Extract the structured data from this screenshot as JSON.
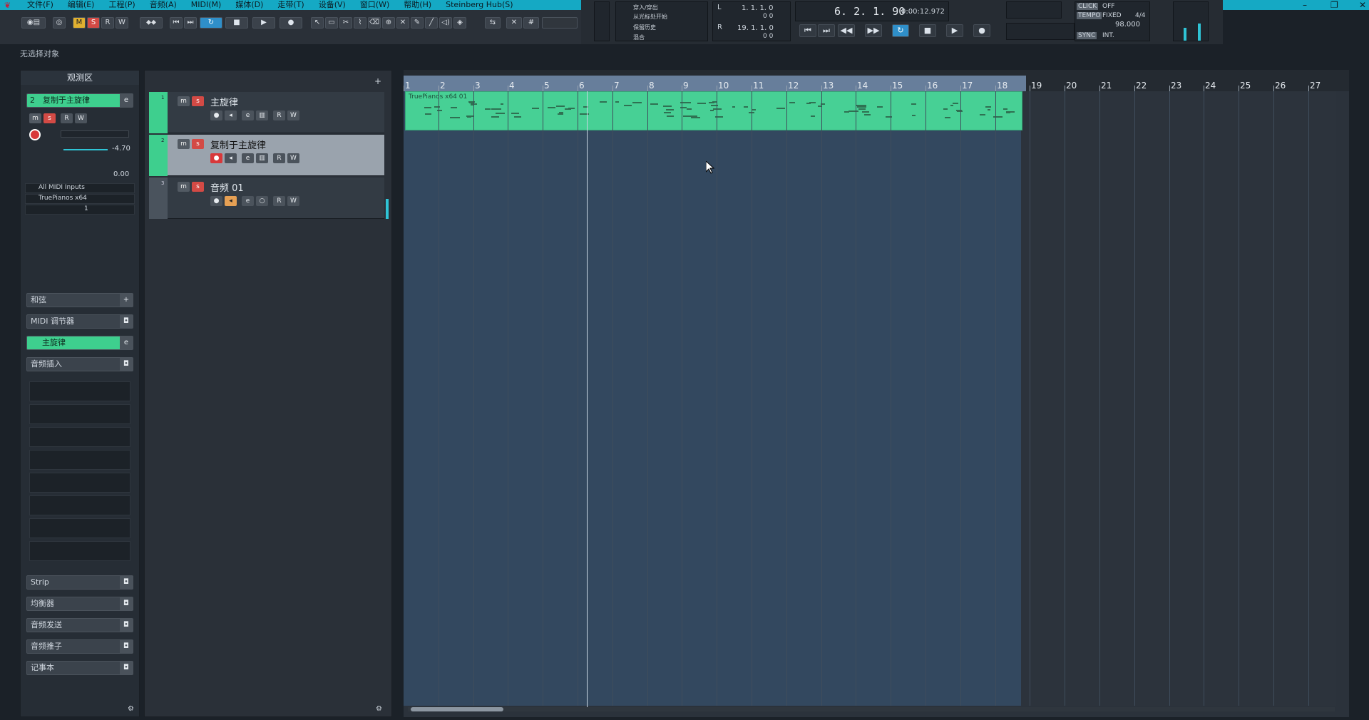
{
  "menubar": {
    "items": [
      "文件(F)",
      "编辑(E)",
      "工程(P)",
      "音频(A)",
      "MIDI(M)",
      "媒体(D)",
      "走带(T)",
      "设备(V)",
      "窗口(W)",
      "帮助(H)",
      "Steinberg Hub(S)"
    ]
  },
  "toolbar": {
    "m_label": "M",
    "s_label": "S",
    "r_label": "R",
    "w_label": "W"
  },
  "transport": {
    "left_locator": "1. 1. 1.   0",
    "left_locator_sub": "0    0",
    "right_locator": "19. 1. 1.   0",
    "right_locator_sub": "0    0",
    "position_bars": "6. 2. 1. 90",
    "position_time": "0:00:12.972",
    "click_label": "CLICK",
    "click_value": "OFF",
    "tempo_label": "TEMPO",
    "tempo_mode": "FIXED",
    "signature": "4/4",
    "tempo_value": "98.000",
    "sync_label": "SYNC",
    "sync_value": "INT.",
    "marker_lines": [
      "穿入/穿出",
      "从光标处开始",
      "保留历史",
      "混合"
    ]
  },
  "status": {
    "no_selection": "无选择对象"
  },
  "inspector": {
    "header": "观测区",
    "track_number": "2",
    "track_name": "复制于主旋律",
    "volume": "-4.70",
    "pan": "0.00",
    "input": "All MIDI Inputs",
    "output": "TruePianos x64",
    "channel": "1",
    "sections": {
      "chord": "和弦",
      "midi_modifiers": "MIDI 调节器",
      "main_melody": "主旋律",
      "audio_inserts": "音频插入",
      "strip": "Strip",
      "eq": "均衡器",
      "sends": "音频发送",
      "fader": "音频推子",
      "notepad": "记事本"
    }
  },
  "tracks": [
    {
      "number": "1",
      "name": "主旋律",
      "selected": false,
      "type": "midi"
    },
    {
      "number": "2",
      "name": "复制于主旋律",
      "selected": true,
      "type": "midi"
    },
    {
      "number": "3",
      "name": "音频 01",
      "selected": false,
      "type": "audio"
    }
  ],
  "ruler": {
    "bars": [
      "1",
      "2",
      "3",
      "4",
      "5",
      "6",
      "7",
      "8",
      "9",
      "10",
      "11",
      "12",
      "13",
      "14",
      "15",
      "16",
      "17",
      "18",
      "19",
      "20",
      "21",
      "22",
      "23",
      "24",
      "25",
      "26",
      "27"
    ]
  },
  "part": {
    "label": "TruePianos x64 01"
  },
  "colors": {
    "accent": "#15a9c4",
    "midi_track": "#3ecf8e",
    "record": "#d8383a",
    "solo": "#d34a45"
  }
}
